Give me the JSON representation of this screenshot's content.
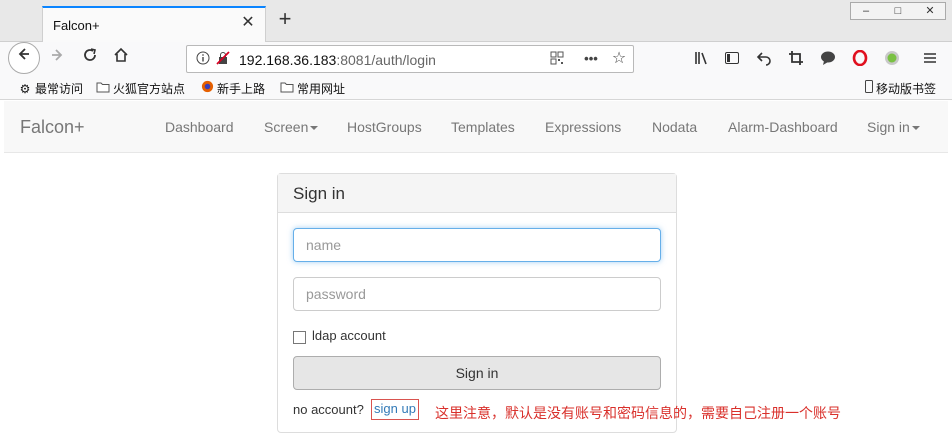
{
  "browser": {
    "tab_title": "Falcon+",
    "tab_close": "✕",
    "new_tab": "+",
    "url_host": "192.168.36.183",
    "url_rest": ":8081/auth/login",
    "icons": [
      "back-icon",
      "forward-icon",
      "reload-icon",
      "home-icon",
      "info-icon",
      "insecure-icon",
      "qr-icon",
      "more-icon",
      "star-icon",
      "library-icon",
      "sidebar-icon",
      "undo-icon",
      "crop-icon",
      "chat-icon",
      "opera-icon",
      "status-dot-icon",
      "menu-icon"
    ],
    "window_controls": [
      "–",
      "□",
      "✕"
    ]
  },
  "bookmarks": {
    "items": [
      {
        "label": "最常访问",
        "icon": "gear-icon"
      },
      {
        "label": "火狐官方站点",
        "icon": "folder-icon"
      },
      {
        "label": "新手上路",
        "icon": "firefox-icon"
      },
      {
        "label": "常用网址",
        "icon": "folder-icon"
      }
    ],
    "mobile": "移动版书签"
  },
  "site": {
    "brand": "Falcon+",
    "nav": [
      "Dashboard",
      "Screen",
      "HostGroups",
      "Templates",
      "Expressions",
      "Nodata",
      "Alarm-Dashboard",
      "Sign in"
    ]
  },
  "login": {
    "title": "Sign in",
    "name_placeholder": "name",
    "password_placeholder": "password",
    "ldap_label": "ldap account",
    "submit_label": "Sign in",
    "no_account": "no account?",
    "signup_label": "sign up"
  },
  "annotation": "这里注意，默认是没有账号和密码信息的，需要自己注册一个账号",
  "colors": {
    "accent": "#0a84ff",
    "annotation": "#d9302b",
    "link": "#337ab7"
  }
}
